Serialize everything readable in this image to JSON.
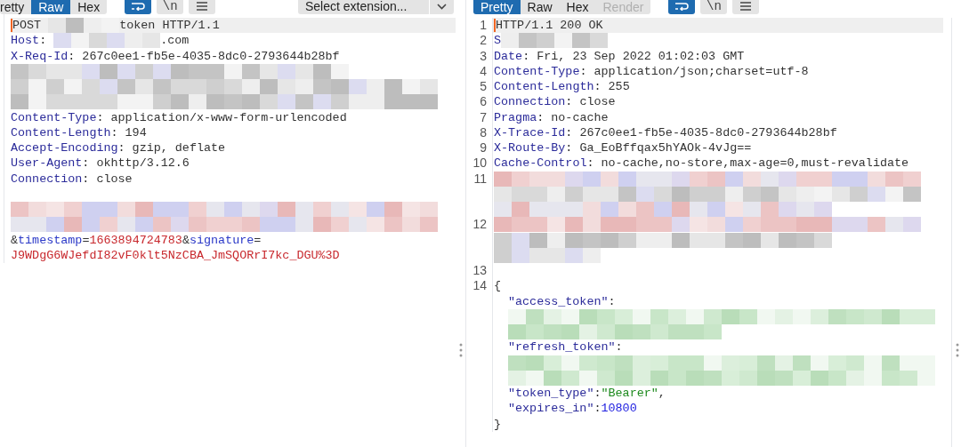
{
  "request": {
    "toolbar": {
      "tabs": [
        {
          "label": "retty",
          "selected": false,
          "disabled": false
        },
        {
          "label": "Raw",
          "selected": true,
          "disabled": false
        },
        {
          "label": "Hex",
          "selected": false,
          "disabled": false
        }
      ],
      "tools": [
        {
          "kind": "wrap",
          "selected": true
        },
        {
          "kind": "newline",
          "label": "\\n",
          "selected": false
        },
        {
          "kind": "menu",
          "selected": false
        }
      ],
      "extension": {
        "value": "Select extension..."
      }
    },
    "lines": [
      {
        "current": true,
        "parts": [
          {
            "kind": "plain",
            "text": "POST "
          },
          {
            "kind": "redacted"
          },
          {
            "kind": "plain",
            "text": "token HTTP/1.1"
          }
        ]
      },
      {
        "current": false,
        "parts": [
          {
            "kind": "header_name",
            "text": "Host"
          },
          {
            "kind": "plain",
            "text": ": "
          },
          {
            "kind": "redacted"
          },
          {
            "kind": "plain",
            "text": ".com"
          }
        ]
      },
      {
        "current": false,
        "parts": [
          {
            "kind": "header_name",
            "text": "X-Req-Id"
          },
          {
            "kind": "plain",
            "text": ": 267c0ee1-fb5e-4035-8dc0-2793644b28bf"
          }
        ]
      },
      {
        "current": false,
        "parts": [
          {
            "kind": "redacted"
          }
        ]
      },
      {
        "current": false,
        "parts": [
          {
            "kind": "redacted"
          }
        ]
      },
      {
        "current": false,
        "parts": [
          {
            "kind": "redacted"
          }
        ]
      },
      {
        "current": false,
        "parts": [
          {
            "kind": "header_name",
            "text": "Content-Type"
          },
          {
            "kind": "plain",
            "text": ": application/x-www-form-urlencoded"
          }
        ]
      },
      {
        "current": false,
        "parts": [
          {
            "kind": "header_name",
            "text": "Content-Length"
          },
          {
            "kind": "plain",
            "text": ": 194"
          }
        ]
      },
      {
        "current": false,
        "parts": [
          {
            "kind": "header_name",
            "text": "Accept-Encoding"
          },
          {
            "kind": "plain",
            "text": ": gzip, deflate"
          }
        ]
      },
      {
        "current": false,
        "parts": [
          {
            "kind": "header_name",
            "text": "User-Agent"
          },
          {
            "kind": "plain",
            "text": ": okhttp/3.12.6"
          }
        ]
      },
      {
        "current": false,
        "parts": [
          {
            "kind": "header_name",
            "text": "Connection"
          },
          {
            "kind": "plain",
            "text": ": close"
          }
        ]
      },
      {
        "current": false
      },
      {
        "current": false,
        "parts": [
          {
            "kind": "redacted"
          }
        ]
      },
      {
        "current": false,
        "parts": [
          {
            "kind": "redacted"
          }
        ]
      },
      {
        "current": false,
        "parts": [
          {
            "kind": "plain",
            "text": "&"
          },
          {
            "kind": "param_name",
            "text": "timestamp"
          },
          {
            "kind": "plain",
            "text": "="
          },
          {
            "kind": "param_value",
            "text": "1663894724783"
          },
          {
            "kind": "plain",
            "text": "&"
          },
          {
            "kind": "param_name",
            "text": "signature"
          },
          {
            "kind": "plain",
            "text": "="
          }
        ]
      },
      {
        "current": false,
        "parts": [
          {
            "kind": "param_value",
            "text": "J9WDgG6WJefdI82vF0klt5NzCBA_JmSQORrI7kc_DGU%3D"
          }
        ]
      }
    ]
  },
  "response": {
    "toolbar": {
      "tabs": [
        {
          "label": "Pretty",
          "selected": true,
          "disabled": false
        },
        {
          "label": "Raw",
          "selected": false,
          "disabled": false
        },
        {
          "label": "Hex",
          "selected": false,
          "disabled": false
        },
        {
          "label": "Render",
          "selected": false,
          "disabled": true
        }
      ],
      "tools": [
        {
          "kind": "wrap",
          "selected": true
        },
        {
          "kind": "newline",
          "label": "\\n",
          "selected": false
        },
        {
          "kind": "menu",
          "selected": false
        }
      ]
    },
    "lines": [
      {
        "number": "1",
        "current": true,
        "parts": [
          {
            "kind": "plain",
            "text": "HTTP/1.1 200 OK"
          }
        ]
      },
      {
        "number": "2",
        "current": false,
        "parts": [
          {
            "kind": "header_name",
            "text": "S"
          },
          {
            "kind": "redacted"
          }
        ]
      },
      {
        "number": "3",
        "current": false,
        "parts": [
          {
            "kind": "header_name",
            "text": "Date"
          },
          {
            "kind": "plain",
            "text": ": Fri, 23 Sep 2022 01:02:03 GMT"
          }
        ]
      },
      {
        "number": "4",
        "current": false,
        "parts": [
          {
            "kind": "header_name",
            "text": "Content-Type"
          },
          {
            "kind": "plain",
            "text": ": application/json;charset=utf-8"
          }
        ]
      },
      {
        "number": "5",
        "current": false,
        "parts": [
          {
            "kind": "header_name",
            "text": "Content-Length"
          },
          {
            "kind": "plain",
            "text": ": 255"
          }
        ]
      },
      {
        "number": "6",
        "current": false,
        "parts": [
          {
            "kind": "header_name",
            "text": "Connection"
          },
          {
            "kind": "plain",
            "text": ": close"
          }
        ]
      },
      {
        "number": "7",
        "current": false,
        "parts": [
          {
            "kind": "header_name",
            "text": "Pragma"
          },
          {
            "kind": "plain",
            "text": ": no-cache"
          }
        ]
      },
      {
        "number": "8",
        "current": false,
        "parts": [
          {
            "kind": "header_name",
            "text": "X-Trace-Id"
          },
          {
            "kind": "plain",
            "text": ": 267c0ee1-fb5e-4035-8dc0-2793644b28bf"
          }
        ]
      },
      {
        "number": "9",
        "current": false,
        "parts": [
          {
            "kind": "header_name",
            "text": "X-Route-By"
          },
          {
            "kind": "plain",
            "text": ": Ga_EoBffqax5hYAOk-4vJg=="
          }
        ]
      },
      {
        "number": "10",
        "current": false,
        "parts": [
          {
            "kind": "header_name",
            "text": "Cache-Control"
          },
          {
            "kind": "plain",
            "text": ": no-cache,no-store,max-age=0,must-revalidate"
          }
        ]
      },
      {
        "number": "11",
        "current": false,
        "parts": [
          {
            "kind": "redacted"
          }
        ]
      },
      {
        "current": false,
        "parts": [
          {
            "kind": "redacted"
          }
        ]
      },
      {
        "current": false,
        "parts": [
          {
            "kind": "redacted"
          }
        ]
      },
      {
        "number": "12",
        "current": false,
        "parts": [
          {
            "kind": "redacted"
          }
        ]
      },
      {
        "current": false,
        "parts": [
          {
            "kind": "redacted"
          }
        ]
      },
      {
        "current": false,
        "parts": [
          {
            "kind": "redacted"
          }
        ]
      },
      {
        "number": "13",
        "current": false
      },
      {
        "number": "14",
        "current": false,
        "parts": [
          {
            "kind": "plain",
            "text": "{"
          }
        ]
      },
      {
        "current": false,
        "indent": true,
        "parts": [
          {
            "kind": "json_key",
            "text": "\"access_token\""
          },
          {
            "kind": "plain",
            "text": ":"
          }
        ]
      },
      {
        "current": false,
        "indent": true,
        "parts": [
          {
            "kind": "redacted"
          }
        ]
      },
      {
        "current": false,
        "indent": true,
        "parts": [
          {
            "kind": "redacted"
          }
        ]
      },
      {
        "current": false,
        "indent": true,
        "parts": [
          {
            "kind": "json_key",
            "text": "\"refresh_token\""
          },
          {
            "kind": "plain",
            "text": ":"
          }
        ]
      },
      {
        "current": false,
        "indent": true,
        "parts": [
          {
            "kind": "redacted"
          }
        ]
      },
      {
        "current": false,
        "indent": true,
        "parts": [
          {
            "kind": "redacted"
          }
        ]
      },
      {
        "current": false,
        "indent": true,
        "parts": [
          {
            "kind": "json_key",
            "text": "\"token_type\""
          },
          {
            "kind": "plain",
            "text": ":"
          },
          {
            "kind": "json_string",
            "text": "\"Bearer\""
          },
          {
            "kind": "plain",
            "text": ","
          }
        ]
      },
      {
        "current": false,
        "indent": true,
        "parts": [
          {
            "kind": "json_key",
            "text": "\"expires_in\""
          },
          {
            "kind": "plain",
            "text": ":"
          },
          {
            "kind": "json_number",
            "text": "10800"
          }
        ]
      },
      {
        "current": false,
        "parts": [
          {
            "kind": "plain",
            "text": "}"
          }
        ]
      }
    ]
  }
}
